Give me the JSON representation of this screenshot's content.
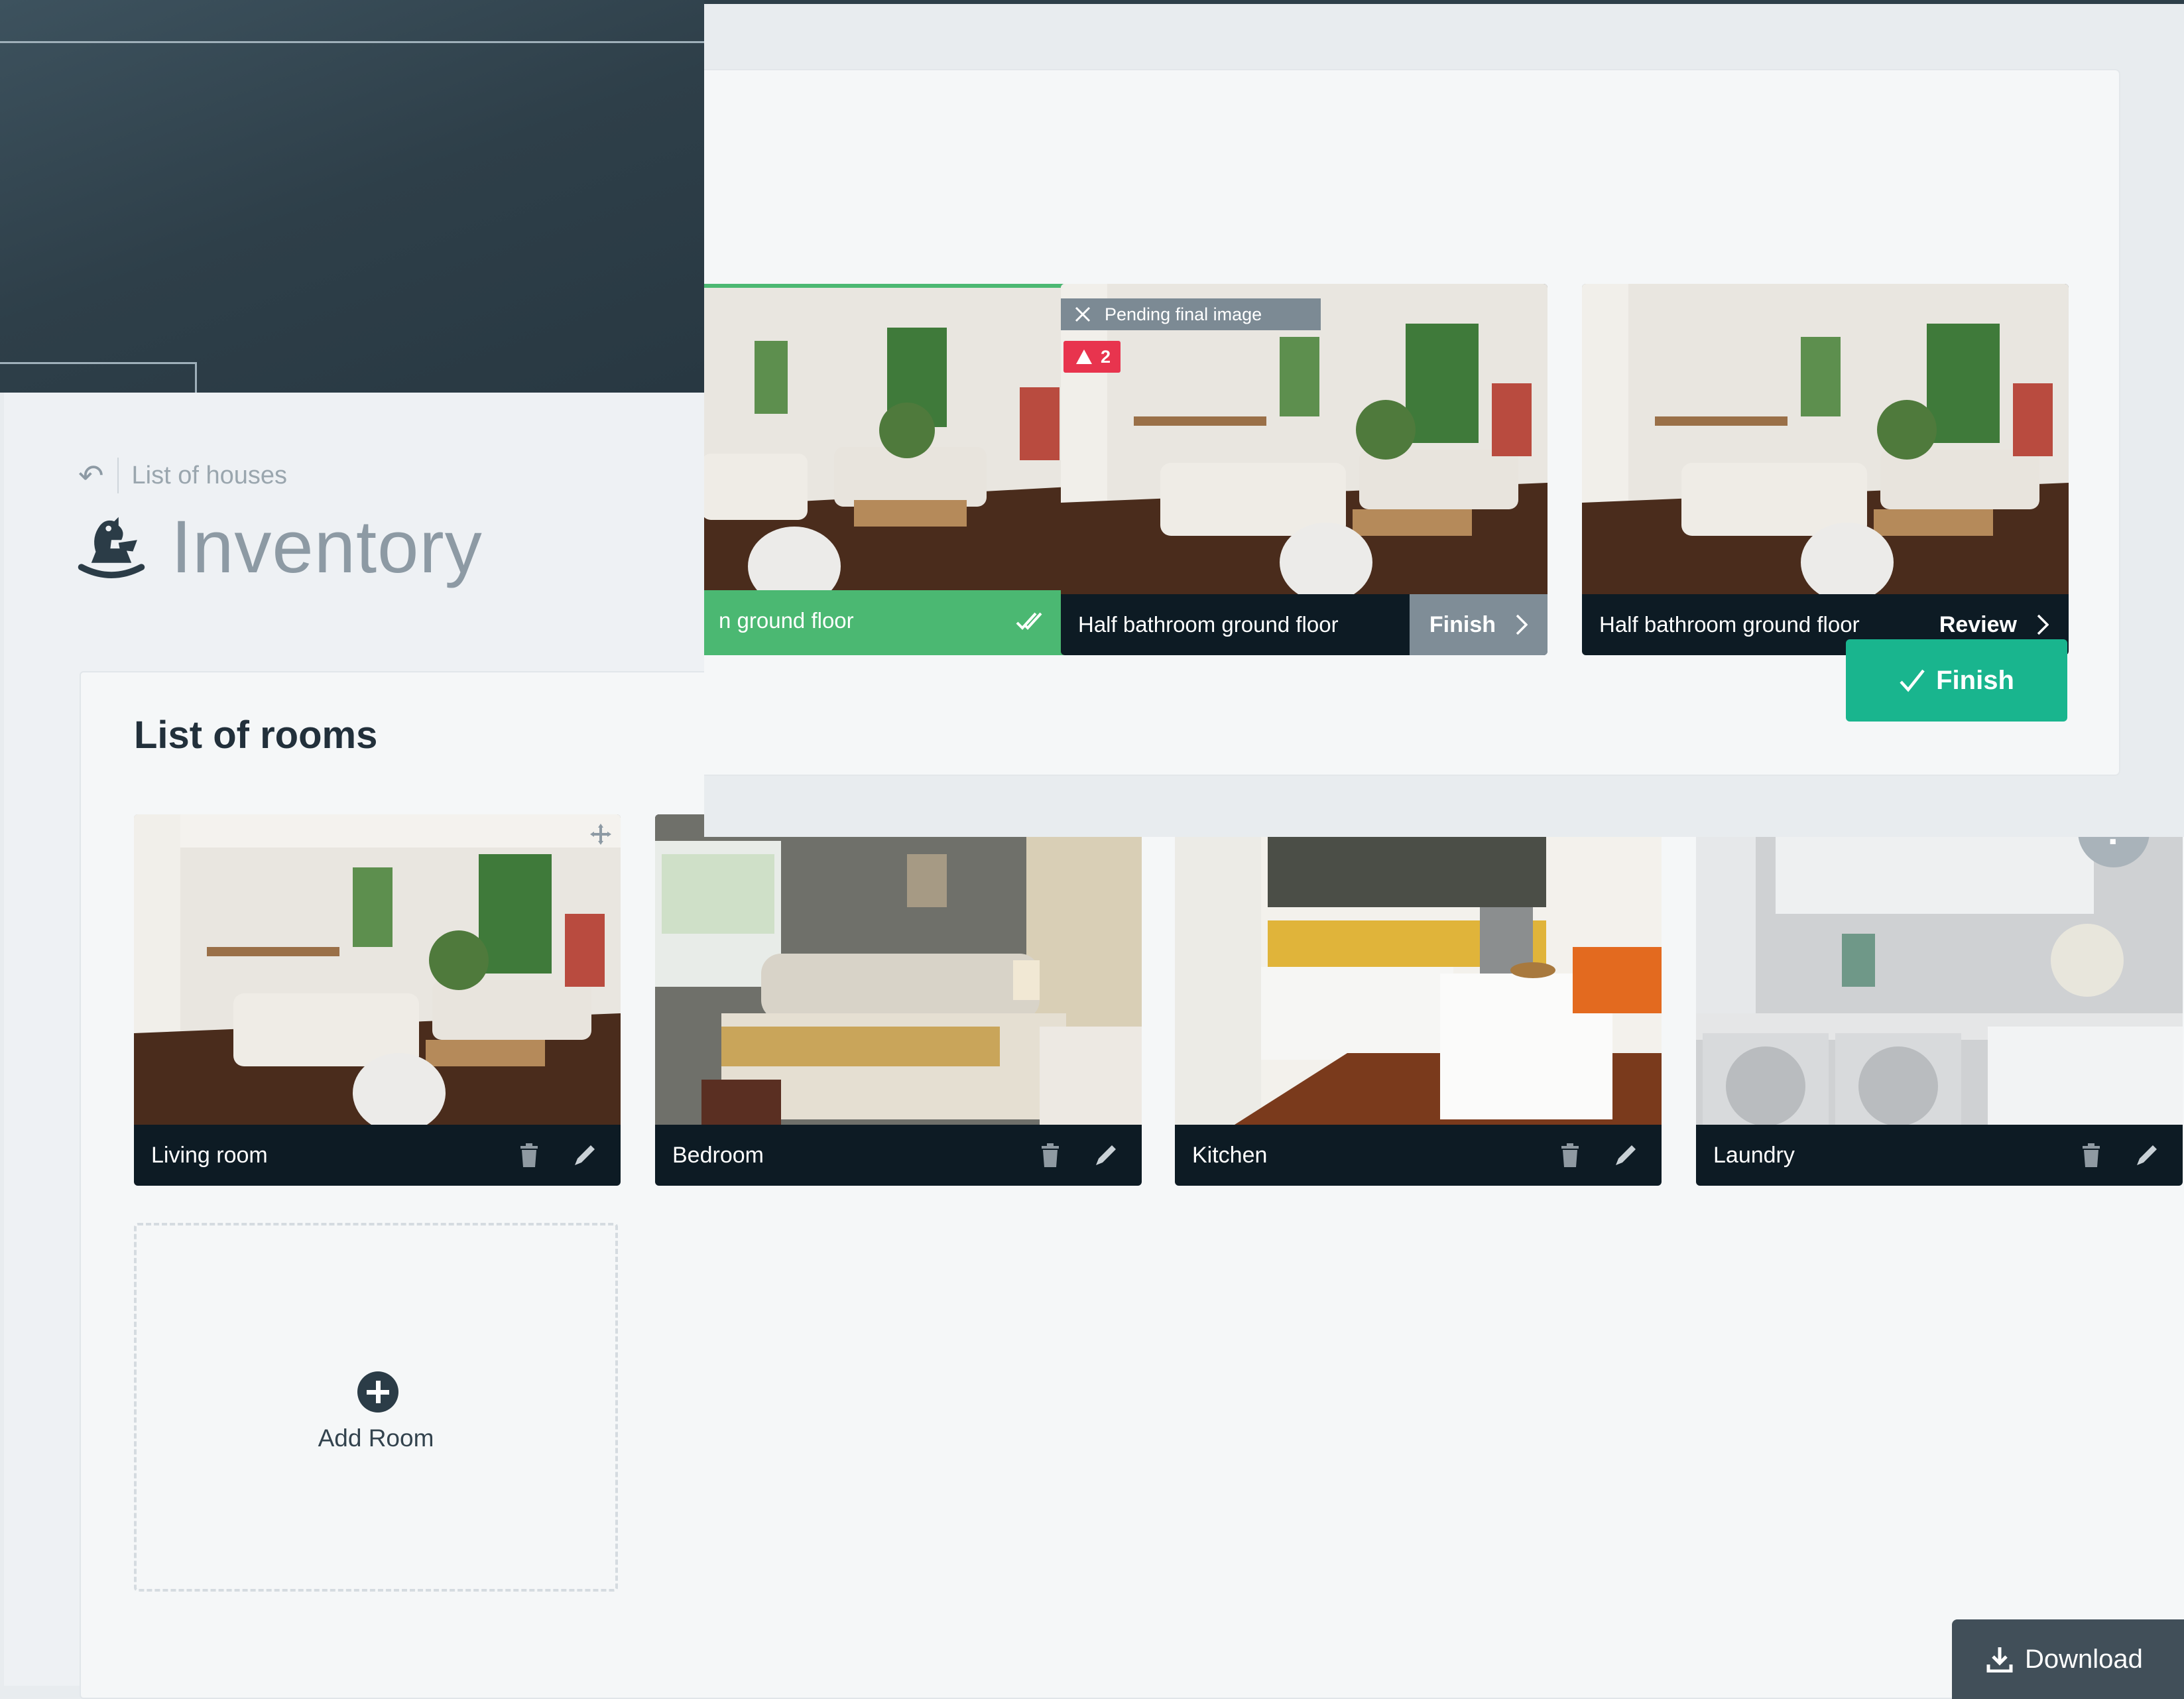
{
  "header": {
    "back_label": "List of houses",
    "page_title": "Inventory"
  },
  "rooms_section": {
    "title": "List of rooms",
    "rooms": [
      {
        "name": "Living room"
      },
      {
        "name": "Bedroom"
      },
      {
        "name": "Kitchen"
      },
      {
        "name": "Laundry"
      }
    ],
    "add_room_label": "Add Room"
  },
  "modal": {
    "photos": [
      {
        "name": "n ground floor",
        "status": "done"
      },
      {
        "name": "Half bathroom ground floor",
        "action": "Finish",
        "pending_label": "Pending final image",
        "alert_count": "2"
      },
      {
        "name": "Half bathroom ground floor",
        "action": "Review"
      }
    ],
    "finish_label": "Finish"
  },
  "help_label": "?",
  "download_label": "Download",
  "colors": {
    "accent_green": "#19b58e",
    "done_green": "#4bb872",
    "alert_red": "#e8344e",
    "dark_bar": "#0d1b24",
    "dark_panel": "#2e3f49"
  }
}
